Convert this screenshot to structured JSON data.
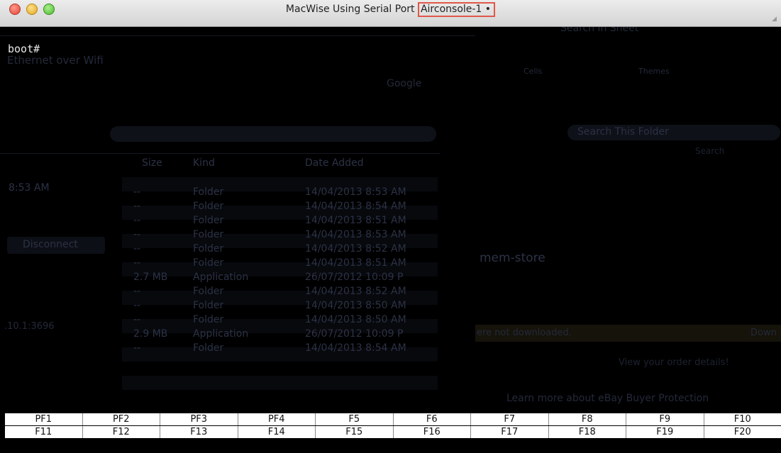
{
  "window": {
    "title_prefix": "MacWise Using Serial Port ",
    "title_port": "Airconsole-1 •"
  },
  "terminal": {
    "prompt": "boot#"
  },
  "background_ghost": {
    "ethernet_label": "Ethernet over Wifi",
    "google_label": "Google",
    "search_sheet": "Search in Sheet",
    "cells_label": "Cells",
    "themes_label": "Themes",
    "search_folder": "Search This Folder",
    "search_label": "Search",
    "col_size": "Size",
    "col_kind": "Kind",
    "col_date": "Date Added",
    "first_time": "8:53 AM",
    "disconnect": "Disconnect",
    "ip_text": ".10.1:3696",
    "mem_store": "mem-store",
    "not_downloaded": "ere not downloaded.",
    "download": "Down",
    "order_details": "View your order details!",
    "ebay_link": "Learn more about eBay Buyer Protection",
    "rows": [
      {
        "size": "--",
        "kind": "Folder",
        "date": "14/04/2013 8:53 AM"
      },
      {
        "size": "--",
        "kind": "Folder",
        "date": "14/04/2013 8:54 AM"
      },
      {
        "size": "--",
        "kind": "Folder",
        "date": "14/04/2013 8:51 AM"
      },
      {
        "size": "--",
        "kind": "Folder",
        "date": "14/04/2013 8:53 AM"
      },
      {
        "size": "--",
        "kind": "Folder",
        "date": "14/04/2013 8:52 AM"
      },
      {
        "size": "--",
        "kind": "Folder",
        "date": "14/04/2013 8:51 AM"
      },
      {
        "size": "2.7 MB",
        "kind": "Application",
        "date": "26/07/2012 10:09 P"
      },
      {
        "size": "--",
        "kind": "Folder",
        "date": "14/04/2013 8:52 AM"
      },
      {
        "size": "--",
        "kind": "Folder",
        "date": "14/04/2013 8:50 AM"
      },
      {
        "size": "--",
        "kind": "Folder",
        "date": "14/04/2013 8:50 AM"
      },
      {
        "size": "2.9 MB",
        "kind": "Application",
        "date": "26/07/2012 10:09 P"
      },
      {
        "size": "--",
        "kind": "Folder",
        "date": "14/04/2013 8:54 AM"
      }
    ]
  },
  "function_keys": {
    "row1": [
      "PF1",
      "PF2",
      "PF3",
      "PF4",
      "F5",
      "F6",
      "F7",
      "F8",
      "F9",
      "F10"
    ],
    "row2": [
      "F11",
      "F12",
      "F13",
      "F14",
      "F15",
      "F16",
      "F17",
      "F18",
      "F19",
      "F20"
    ]
  }
}
